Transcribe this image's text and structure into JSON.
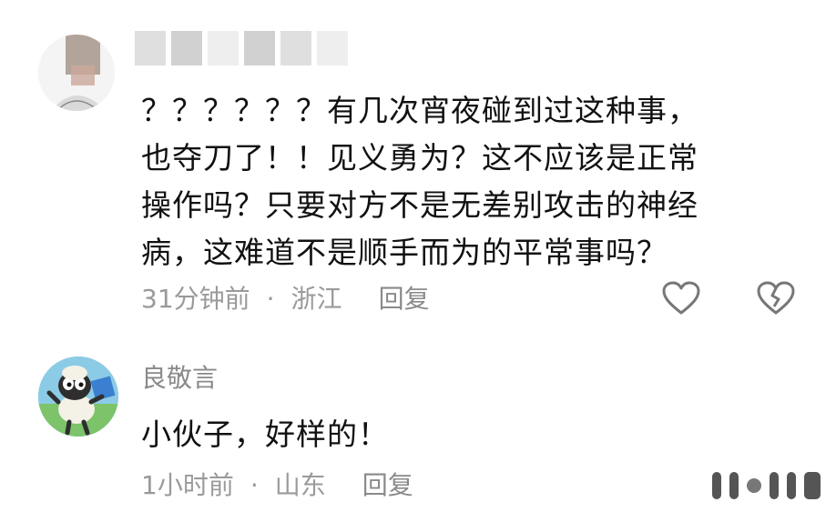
{
  "comments": [
    {
      "username": "",
      "text_lines": [
        "？？？？？？有几次宵夜碰到过这种事，",
        "也夺刀了！！见义勇为？这不应该是正常",
        "操作吗？只要对方不是无差别攻击的神经",
        "病，这难道不是顺手而为的平常事吗？"
      ],
      "time": "31分钟前",
      "separator": "·",
      "location": "浙江",
      "reply_label": "回复",
      "avatar_icon": "user-avatar-blurred",
      "like_icon": "heart-outline-icon",
      "dislike_icon": "broken-heart-icon"
    },
    {
      "username": "良敬言",
      "text_lines": [
        "小伙子，好样的！"
      ],
      "time": "1小时前",
      "separator": "·",
      "location": "山东",
      "reply_label": "回复",
      "avatar_icon": "cartoon-sheep-avatar"
    }
  ],
  "colors": {
    "text": "#111111",
    "meta": "#9a9a9a",
    "username": "#8a8a8a",
    "icon": "#777777"
  }
}
